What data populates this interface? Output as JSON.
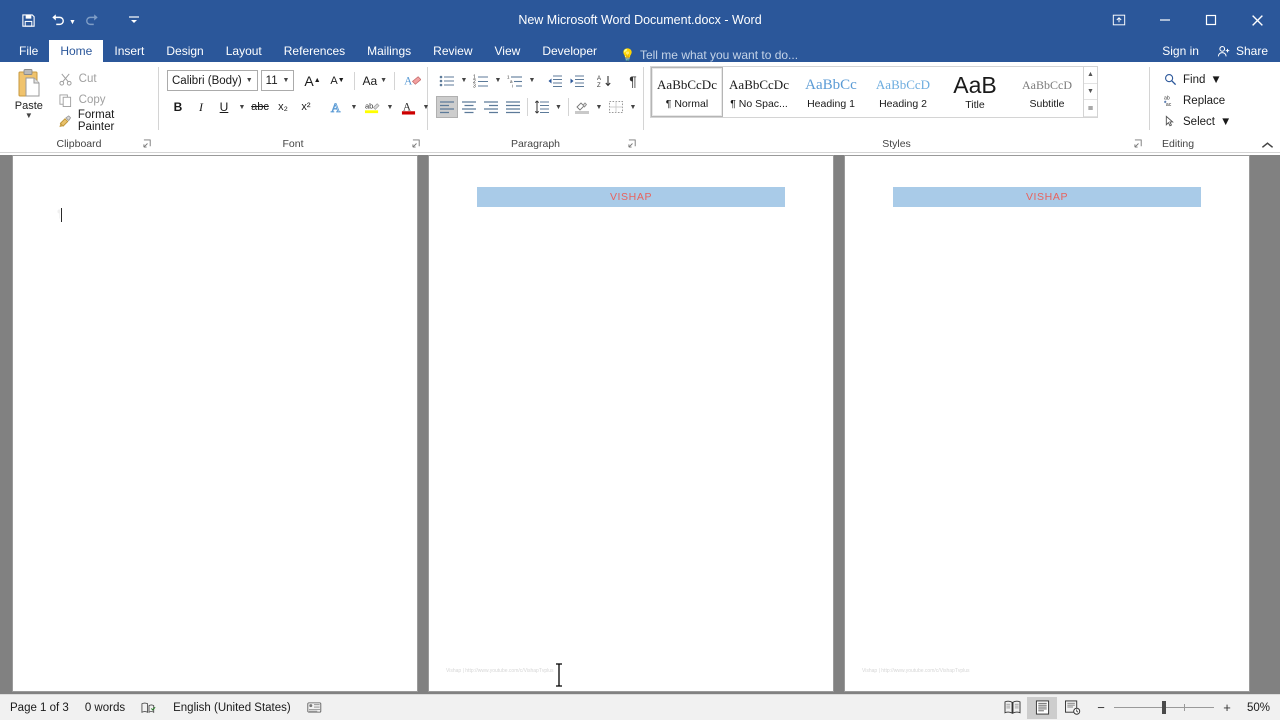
{
  "window": {
    "title": "New Microsoft Word Document.docx - Word",
    "quick_access": [
      {
        "name": "save",
        "icon": "save-icon"
      },
      {
        "name": "undo",
        "icon": "undo-icon"
      },
      {
        "name": "redo",
        "icon": "redo-icon"
      },
      {
        "name": "customize-quick-access-toolbar",
        "icon": "chevron-down-icon"
      }
    ],
    "controls": {
      "ribbon_display_options": "ribbon-display-options-icon",
      "minimize": "minimize-icon",
      "restore": "restore-icon",
      "close": "close-icon"
    }
  },
  "tabs": [
    {
      "label": "File",
      "active": false
    },
    {
      "label": "Home",
      "active": true
    },
    {
      "label": "Insert",
      "active": false
    },
    {
      "label": "Design",
      "active": false
    },
    {
      "label": "Layout",
      "active": false
    },
    {
      "label": "References",
      "active": false
    },
    {
      "label": "Mailings",
      "active": false
    },
    {
      "label": "Review",
      "active": false
    },
    {
      "label": "View",
      "active": false
    },
    {
      "label": "Developer",
      "active": false
    }
  ],
  "tell_me": "Tell me what you want to do...",
  "account": {
    "sign_in": "Sign in",
    "share": "Share"
  },
  "ribbon": {
    "clipboard": {
      "group_label": "Clipboard",
      "paste_label": "Paste",
      "items": [
        {
          "label": "Cut",
          "icon": "scissors-icon",
          "enabled": false
        },
        {
          "label": "Copy",
          "icon": "copy-icon",
          "enabled": false
        },
        {
          "label": "Format Painter",
          "icon": "paintbrush-icon",
          "enabled": true
        }
      ]
    },
    "font": {
      "group_label": "Font",
      "font_name": "Calibri (Body)",
      "font_size": "11",
      "buttons": [
        {
          "name": "grow-font",
          "label": "A"
        },
        {
          "name": "shrink-font",
          "label": "A"
        },
        {
          "name": "change-case",
          "label": "Aa"
        },
        {
          "name": "clear-formatting",
          "label": "A"
        },
        {
          "name": "bold",
          "label": "B"
        },
        {
          "name": "italic",
          "label": "I"
        },
        {
          "name": "underline",
          "label": "U"
        },
        {
          "name": "strikethrough",
          "label": "abc"
        },
        {
          "name": "subscript",
          "label": "x₂"
        },
        {
          "name": "superscript",
          "label": "x²"
        },
        {
          "name": "text-effects",
          "label": "A"
        },
        {
          "name": "text-highlight-color",
          "label": "ab"
        },
        {
          "name": "font-color",
          "label": "A"
        }
      ]
    },
    "paragraph": {
      "group_label": "Paragraph",
      "buttons": [
        {
          "name": "bullets",
          "icon": "bullet-list-icon"
        },
        {
          "name": "numbering",
          "icon": "numbered-list-icon"
        },
        {
          "name": "multilevel-list",
          "icon": "multilevel-list-icon"
        },
        {
          "name": "decrease-indent",
          "icon": "decrease-indent-icon"
        },
        {
          "name": "increase-indent",
          "icon": "increase-indent-icon"
        },
        {
          "name": "sort",
          "icon": "sort-az-icon"
        },
        {
          "name": "show-formatting-marks",
          "icon": "pilcrow-icon"
        },
        {
          "name": "align-left",
          "icon": "align-left-icon",
          "active": true
        },
        {
          "name": "align-center",
          "icon": "align-center-icon"
        },
        {
          "name": "align-right",
          "icon": "align-right-icon"
        },
        {
          "name": "justify",
          "icon": "justify-icon"
        },
        {
          "name": "line-spacing",
          "icon": "line-spacing-icon"
        },
        {
          "name": "shading",
          "icon": "shading-icon"
        },
        {
          "name": "borders",
          "icon": "borders-icon"
        }
      ]
    },
    "styles": {
      "group_label": "Styles",
      "items": [
        {
          "preview": "AaBbCcDc",
          "name": "¶ Normal",
          "selected": true,
          "color": "#1a1a1a",
          "size": "13px",
          "bold": false
        },
        {
          "preview": "AaBbCcDc",
          "name": "¶ No Spac...",
          "selected": false,
          "color": "#1a1a1a",
          "size": "13px",
          "bold": false
        },
        {
          "preview": "AaBbCс",
          "name": "Heading 1",
          "selected": false,
          "color": "#5b9bd5",
          "size": "15px",
          "bold": false
        },
        {
          "preview": "AaBbCcD",
          "name": "Heading 2",
          "selected": false,
          "color": "#6cacdf",
          "size": "13px",
          "bold": false
        },
        {
          "preview": "AaB",
          "name": "Title",
          "selected": false,
          "color": "#1a1a1a",
          "size": "24px",
          "bold": false
        },
        {
          "preview": "AaBbCcD",
          "name": "Subtitle",
          "selected": false,
          "color": "#7a7a7a",
          "size": "12px",
          "bold": false
        }
      ],
      "scroll": [
        "▲",
        "▼",
        "≣"
      ]
    },
    "editing": {
      "group_label": "Editing",
      "items": [
        {
          "label": "Find",
          "icon": "magnifier-icon",
          "has_caret": true
        },
        {
          "label": "Replace",
          "icon": "replace-icon",
          "has_caret": false
        },
        {
          "label": "Select",
          "icon": "cursor-arrow-icon",
          "has_caret": true
        }
      ]
    },
    "collapse_icon": "chevron-up-icon"
  },
  "document": {
    "pages": [
      {
        "header": "",
        "footer": "",
        "has_caret": true
      },
      {
        "header": "VISHAP",
        "footer": "Vishap | http://www.youtube.com/c/VishapTvplus",
        "has_caret": false
      },
      {
        "header": "VISHAP",
        "footer": "Vishap | http://www.youtube.com/c/VishapTvplus",
        "has_caret": false
      }
    ],
    "header_bg": "#a9cbe8",
    "header_fg": "#e8625d"
  },
  "status_bar": {
    "page": "Page 1 of 3",
    "words": "0 words",
    "proofing_icon": "proofing-errors-icon",
    "language": "English (United States)",
    "macro_icon": "macro-record-icon",
    "views": [
      {
        "name": "read-mode",
        "icon": "read-mode-icon",
        "active": false
      },
      {
        "name": "print-layout",
        "icon": "print-layout-icon",
        "active": true
      },
      {
        "name": "web-layout",
        "icon": "web-layout-icon",
        "active": false
      }
    ],
    "zoom_out": "−",
    "zoom_in": "+",
    "zoom_level": "50%"
  }
}
